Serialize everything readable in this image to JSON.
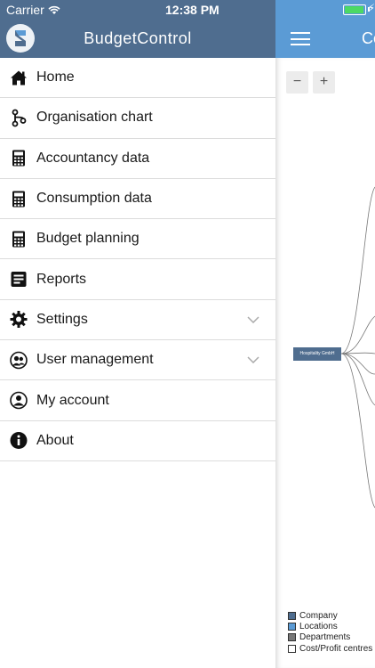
{
  "status_bar": {
    "carrier": "Carrier",
    "time": "12:38 PM",
    "battery_level": 0.95
  },
  "drawer": {
    "app_title": "BudgetControl",
    "menu": [
      {
        "label": "Home",
        "icon": "home-icon"
      },
      {
        "label": "Organisation chart",
        "icon": "org-chart-icon"
      },
      {
        "label": "Accountancy data",
        "icon": "calculator-icon"
      },
      {
        "label": "Consumption data",
        "icon": "calculator-icon"
      },
      {
        "label": "Budget planning",
        "icon": "calculator-icon"
      },
      {
        "label": "Reports",
        "icon": "report-icon"
      },
      {
        "label": "Settings",
        "icon": "gear-icon",
        "expandable": true
      },
      {
        "label": "User management",
        "icon": "users-icon",
        "expandable": true
      },
      {
        "label": "My account",
        "icon": "user-icon"
      },
      {
        "label": "About",
        "icon": "info-icon"
      }
    ]
  },
  "main": {
    "header_title": "Co",
    "zoom_out_label": "−",
    "zoom_in_label": "+",
    "root_node": "Hospitality GmbH",
    "legend": [
      {
        "label": "Company",
        "color": "#4f6d8f"
      },
      {
        "label": "Locations",
        "color": "#5b9bd5"
      },
      {
        "label": "Departments",
        "color": "#777777"
      },
      {
        "label": "Cost/Profit centres",
        "color": "#ffffff"
      }
    ]
  },
  "colors": {
    "drawer_header": "#4f6d8f",
    "app_header": "#5b9bd5",
    "divider": "#dcdcdc"
  }
}
